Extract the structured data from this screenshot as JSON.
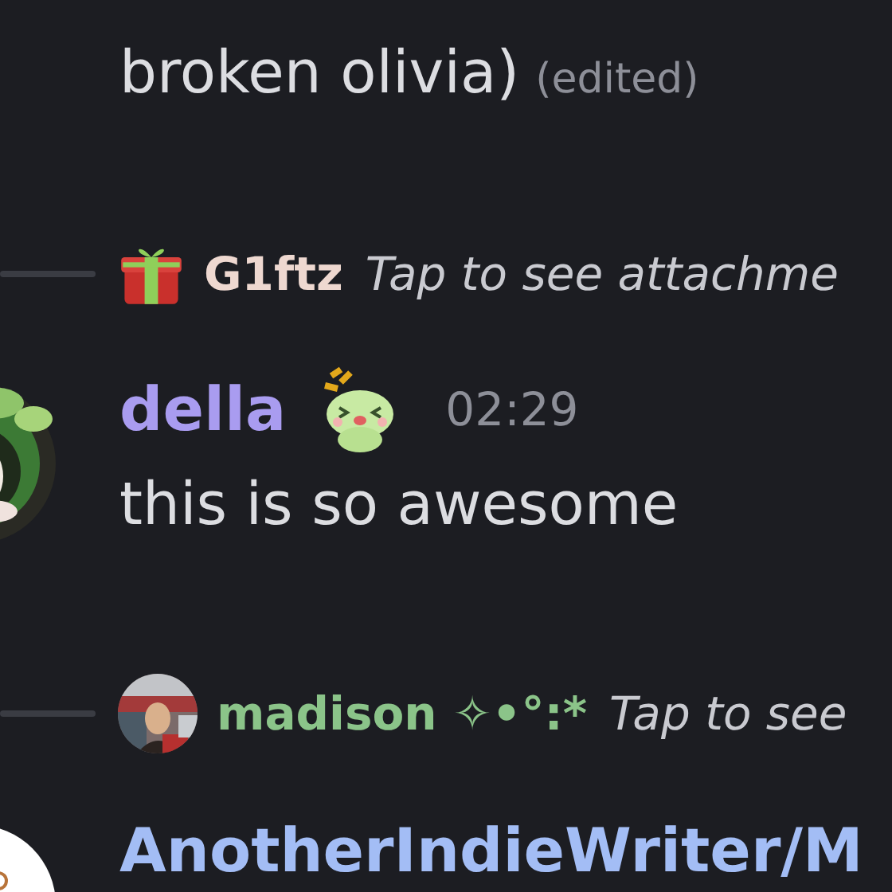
{
  "messages": [
    {
      "kind": "continuation",
      "text": "broken olivia)",
      "edited": "(edited)"
    },
    {
      "kind": "reply",
      "author": "G1ftz",
      "color": "#eed8d0",
      "preview": "Tap to see attachme"
    },
    {
      "kind": "message",
      "author": "della",
      "color": "#a99cf0",
      "time": "02:29",
      "text": "this is so awesome"
    },
    {
      "kind": "reply",
      "author": "madison ✧•°:*",
      "color": "#8bc489",
      "preview": "Tap to see"
    },
    {
      "kind": "message",
      "author": "AnotherIndieWriter/M",
      "color": "#a3bdf5"
    }
  ]
}
